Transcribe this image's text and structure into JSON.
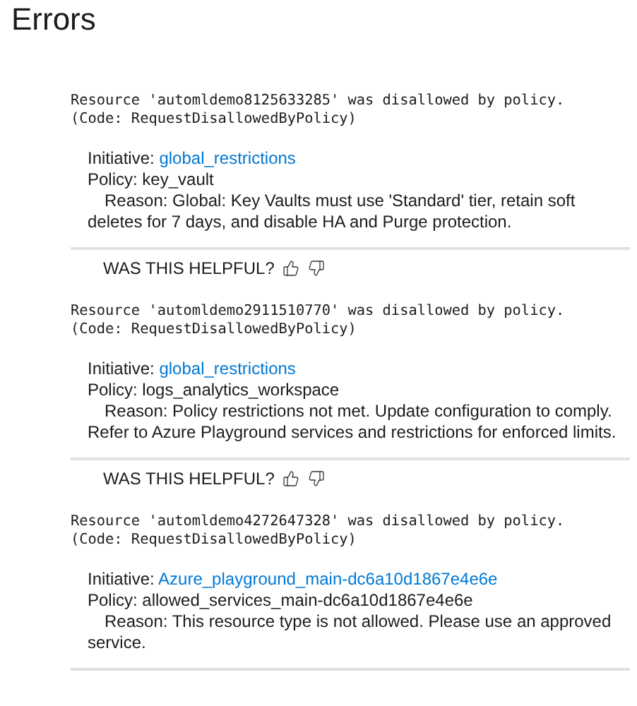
{
  "title": "Errors",
  "errors": [
    {
      "message": "Resource 'automldemo8125633285' was disallowed by policy.",
      "code": "(Code: RequestDisallowedByPolicy)",
      "initiative_label": "Initiative:",
      "initiative": "global_restrictions",
      "policy": "Policy: key_vault",
      "reason": "Reason: Global: Key Vaults must use 'Standard' tier, retain soft deletes for 7 days, and disable HA and Purge protection.",
      "feedback": "WAS THIS HELPFUL?"
    },
    {
      "message": "Resource 'automldemo2911510770' was disallowed by policy.",
      "code": "(Code: RequestDisallowedByPolicy)",
      "initiative_label": "Initiative:",
      "initiative": "global_restrictions",
      "policy": "Policy: logs_analytics_workspace",
      "reason": "Reason: Policy restrictions not met. Update configuration to comply. Refer to Azure Playground services and restrictions for enforced limits.",
      "feedback": "WAS THIS HELPFUL?"
    },
    {
      "message": "Resource 'automldemo4272647328' was disallowed by policy.",
      "code": "(Code: RequestDisallowedByPolicy)",
      "initiative_label": "Initiative:",
      "initiative": "Azure_playground_main-dc6a10d1867e4e6e",
      "policy": "Policy: allowed_services_main-dc6a10d1867e4e6e",
      "reason": "Reason: This resource type is not allowed. Please use an approved service."
    }
  ]
}
